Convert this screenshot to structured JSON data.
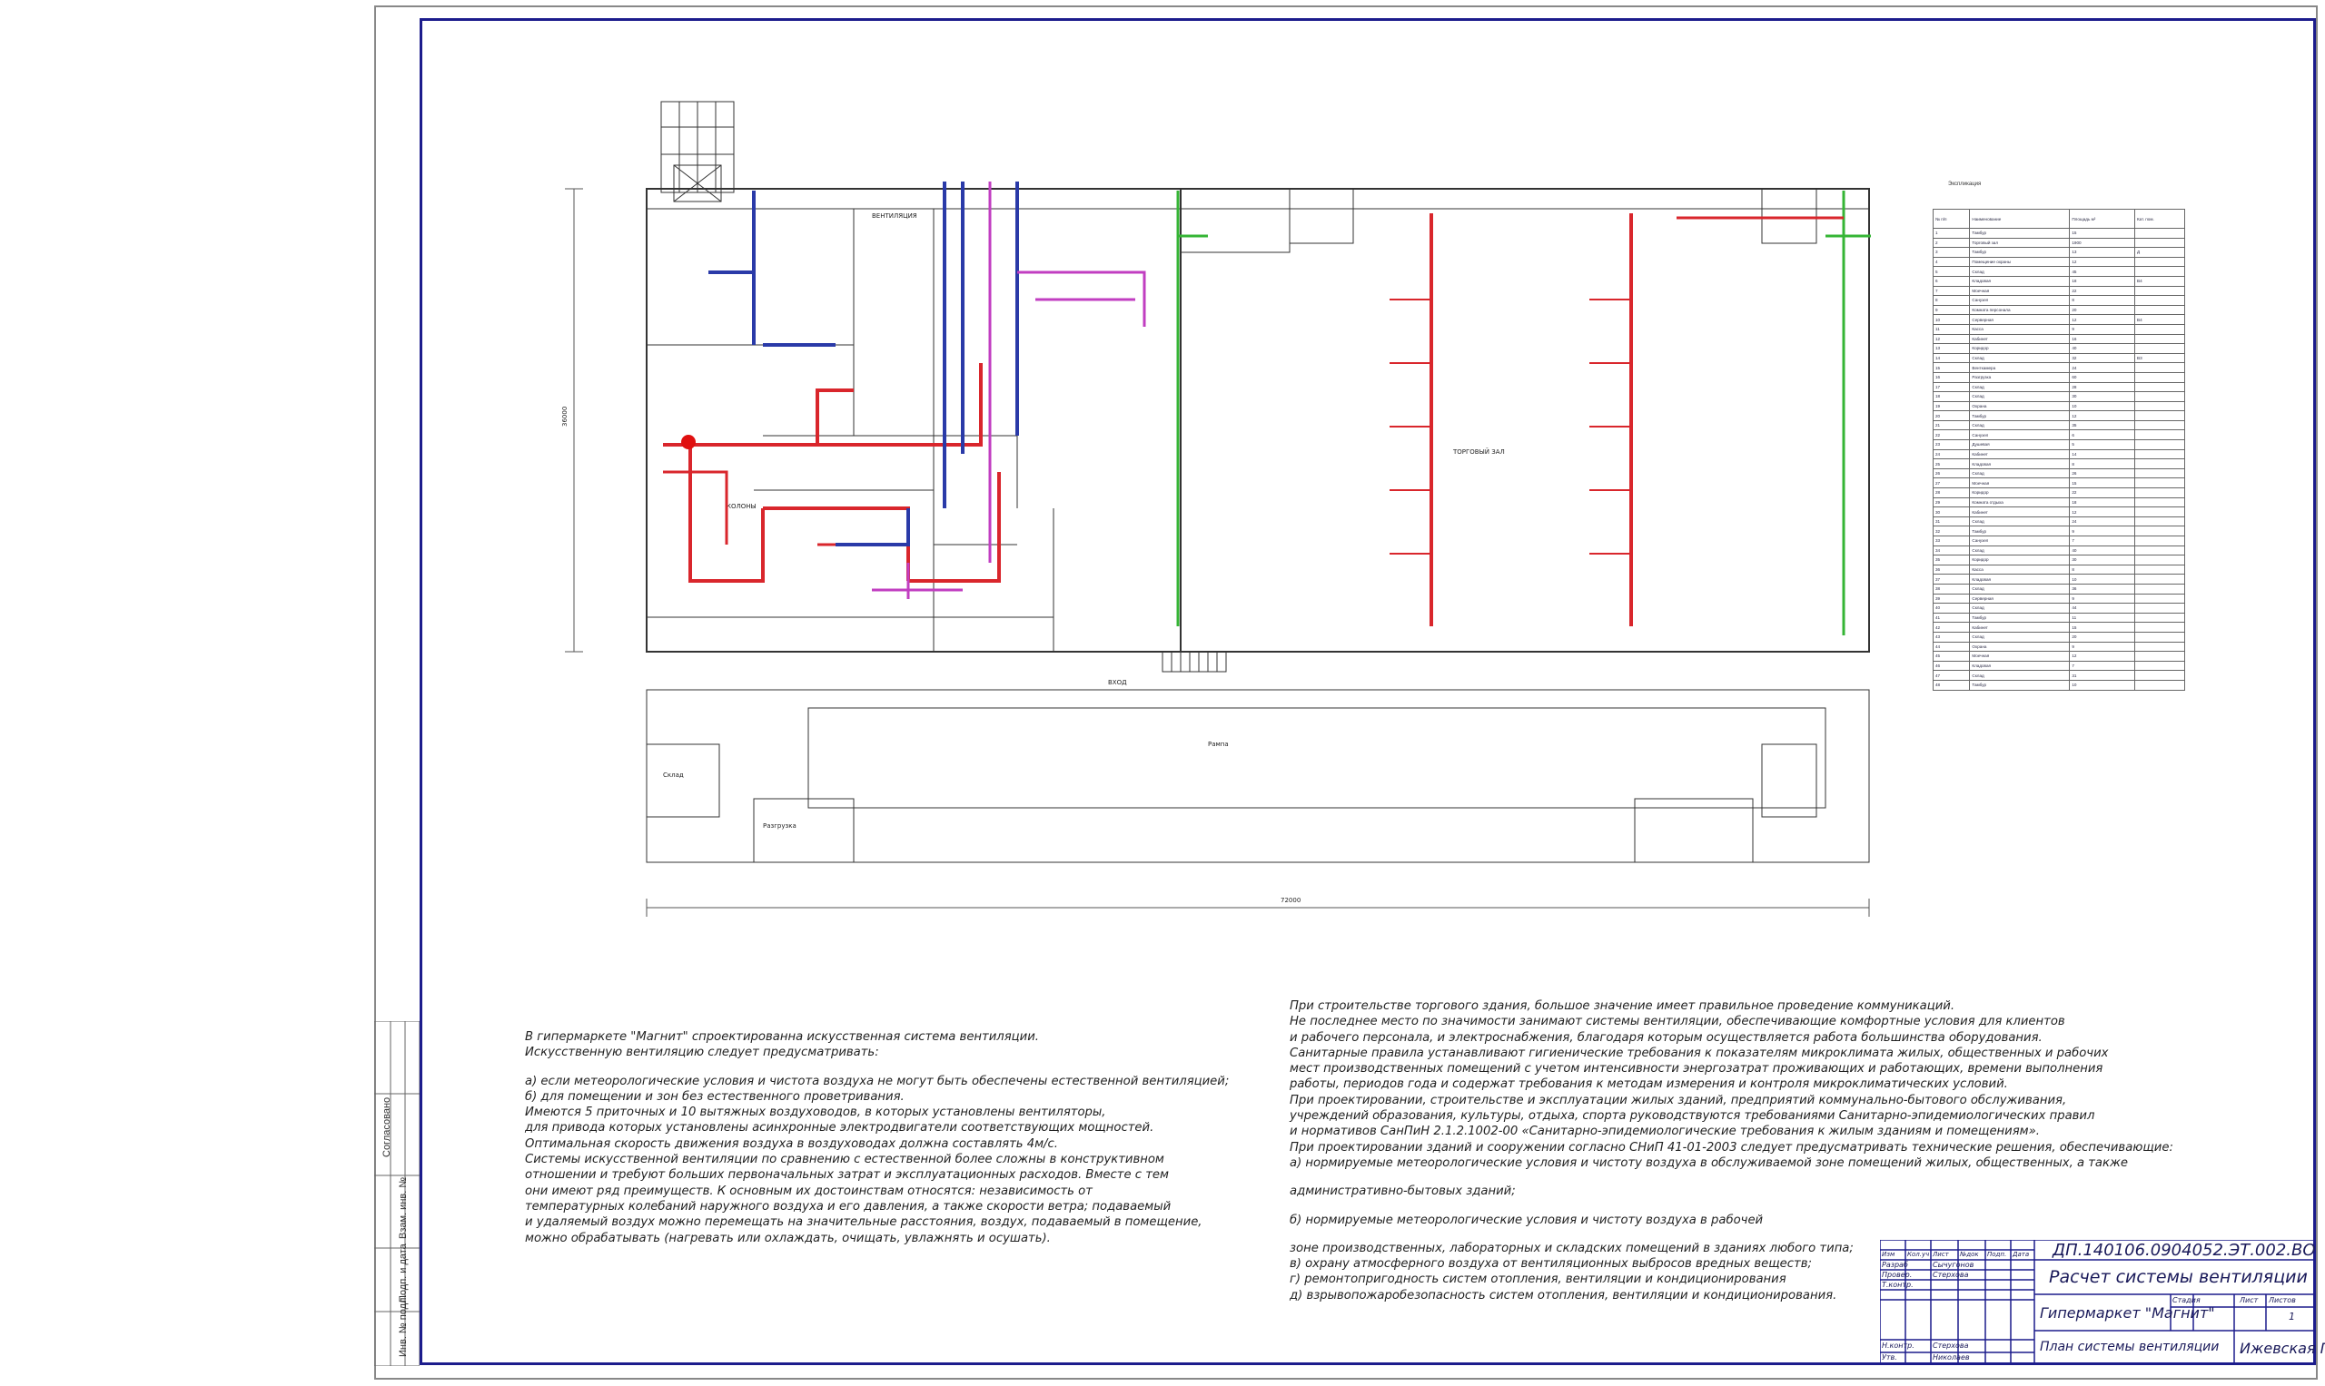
{
  "drawing": {
    "rooms": [
      "КОЛОНЫ",
      "ВЕНТИЛЯЦИЯ",
      "ТОРГОВЫЙ ЗАЛ",
      "ВХОД",
      "Тамбур",
      "Склад",
      "Разгрузка",
      "Охрана",
      "Касса",
      "Серверная",
      "Санузел",
      "Кабинет",
      "Моечная",
      "Кладовая"
    ],
    "dimension_bottom": "72000",
    "dimension_left": "36000",
    "entrance_label": "ВХОД",
    "loading_label": "Рампа"
  },
  "spec_table": {
    "title": "Экспликация",
    "headers": [
      "№ п/п",
      "Наименование",
      "Площадь м²",
      "Кат. пом."
    ],
    "rows": [
      [
        "1",
        "Тамбур",
        "15",
        ""
      ],
      [
        "2",
        "Торговый зал",
        "1900",
        ""
      ],
      [
        "3",
        "Тамбур",
        "13",
        "Д"
      ],
      [
        "4",
        "Помещение охраны",
        "12",
        ""
      ],
      [
        "5",
        "Склад",
        "45",
        ""
      ],
      [
        "6",
        "Кладовая",
        "18",
        "В4"
      ],
      [
        "7",
        "Моечная",
        "22",
        ""
      ],
      [
        "8",
        "Санузел",
        "8",
        ""
      ],
      [
        "9",
        "Комната персонала",
        "20",
        ""
      ],
      [
        "10",
        "Серверная",
        "12",
        "В4"
      ],
      [
        "11",
        "Касса",
        "9",
        ""
      ],
      [
        "12",
        "Кабинет",
        "16",
        ""
      ],
      [
        "13",
        "Коридор",
        "40",
        ""
      ],
      [
        "14",
        "Склад",
        "32",
        "В3"
      ],
      [
        "15",
        "Венткамера",
        "24",
        ""
      ],
      [
        "16",
        "Разгрузка",
        "60",
        ""
      ],
      [
        "17",
        "Склад",
        "28",
        ""
      ],
      [
        "18",
        "Склад",
        "30",
        ""
      ],
      [
        "19",
        "Охрана",
        "10",
        ""
      ],
      [
        "20",
        "Тамбур",
        "12",
        ""
      ],
      [
        "21",
        "Склад",
        "35",
        ""
      ],
      [
        "22",
        "Санузел",
        "6",
        ""
      ],
      [
        "23",
        "Душевая",
        "5",
        ""
      ],
      [
        "24",
        "Кабинет",
        "14",
        ""
      ],
      [
        "25",
        "Кладовая",
        "8",
        ""
      ],
      [
        "26",
        "Склад",
        "26",
        ""
      ],
      [
        "27",
        "Моечная",
        "15",
        ""
      ],
      [
        "28",
        "Коридор",
        "22",
        ""
      ],
      [
        "29",
        "Комната отдыха",
        "18",
        ""
      ],
      [
        "30",
        "Кабинет",
        "12",
        ""
      ],
      [
        "31",
        "Склад",
        "24",
        ""
      ],
      [
        "32",
        "Тамбур",
        "9",
        ""
      ],
      [
        "33",
        "Санузел",
        "7",
        ""
      ],
      [
        "34",
        "Склад",
        "40",
        ""
      ],
      [
        "35",
        "Коридор",
        "30",
        ""
      ],
      [
        "36",
        "Касса",
        "8",
        ""
      ],
      [
        "37",
        "Кладовая",
        "10",
        ""
      ],
      [
        "38",
        "Склад",
        "36",
        ""
      ],
      [
        "39",
        "Серверная",
        "9",
        ""
      ],
      [
        "40",
        "Склад",
        "44",
        ""
      ],
      [
        "41",
        "Тамбур",
        "11",
        ""
      ],
      [
        "42",
        "Кабинет",
        "15",
        ""
      ],
      [
        "43",
        "Склад",
        "20",
        ""
      ],
      [
        "44",
        "Охрана",
        "9",
        ""
      ],
      [
        "45",
        "Моечная",
        "12",
        ""
      ],
      [
        "46",
        "Кладовая",
        "7",
        ""
      ],
      [
        "47",
        "Склад",
        "31",
        ""
      ],
      [
        "48",
        "Тамбур",
        "10",
        ""
      ]
    ]
  },
  "notes_left": {
    "lines": [
      "В гипермаркете \"Магнит\" спроектированна искусственная система вентиляции.",
      "Искусственную вентиляцию следует предусматривать:",
      "",
      "а) если метеорологические условия и чистота воздуха не могут быть обеспечены естественной вентиляцией;",
      "б) для помещении и зон без естественного проветривания.",
      "Имеются 5 приточных и 10 вытяжных воздуховодов, в которых установлены вентиляторы,",
      "для привода которых установлены асинхронные электродвигатели соответствующих мощностей.",
      "Оптимальная скорость движения воздуха в воздуховодах должна составлять 4м/с.",
      "Системы искусственной вентиляции по сравнению с естественной более сложны в конструктивном",
      "отношении и требуют больших первоначальных затрат и эксплуатационных расходов. Вместе с тем",
      "они имеют ряд преимуществ. К основным их достоинствам относятся: независимость от",
      "температурных колебаний наружного воздуха и его давления, а также скорости ветра; подаваемый",
      "и удаляемый воздух можно перемещать на значительные расстояния, воздух, подаваемый в помещение,",
      "можно обрабатывать (нагревать или охлаждать, очищать, увлажнять и осушать)."
    ]
  },
  "notes_right": {
    "lines": [
      "При строительстве торгового здания, большое значение имеет правильное проведение коммуникаций.",
      "Не последнее место по значимости занимают системы вентиляции, обеспечивающие комфортные условия для клиентов",
      "и рабочего персонала, и электроснабжения, благодаря которым осуществляется работа большинства оборудования.",
      "Санитарные правила устанавливают гигиенические требования к показателям микроклимата жилых, общественных и рабочих",
      "мест производственных помещений с учетом интенсивности энергозатрат проживающих и работающих, времени выполнения",
      "работы, периодов года и содержат требования к методам измерения и контроля микроклиматических условий.",
      "При проектировании, строительстве и эксплуатации жилых зданий, предприятий коммунально-бытового обслуживания,",
      "учреждений образования, культуры, отдыха, спорта руководствуются требованиями Санитарно-эпидемиологических правил",
      " и нормативов СанПиН 2.1.2.1002-00 «Санитарно-эпидемиологические требования к жилым зданиям и помещениям».",
      "При проектировании зданий и сооружении согласно СНиП 41-01-2003 следует предусматривать технические решения, обеспечивающие:",
      "а) нормируемые метеорологические условия и чистоту воздуха в обслуживаемой зоне помещений жилых, общественных, а также",
      "",
      "административно-бытовых зданий;",
      "",
      "б) нормируемые метеорологические условия и чистоту воздуха в рабочей",
      "",
      "зоне производственных, лабораторных и складских помещений в зданиях любого типа;",
      "в) охрану атмосферного воздуха от вентиляционных выбросов вредных веществ;",
      "г) ремонтопригодность систем отопления, вентиляции и кондиционирования",
      "д) взрывопожаробезопасность систем отопления, вентиляции и кондиционирования."
    ]
  },
  "title_block": {
    "code": "ДП.140106.0904052.ЭТ.002.ВО",
    "title": "Расчет системы вентиляции",
    "object": "Гипермаркет \"Магнит\"",
    "sheet_name": "План системы вентиляции",
    "org": "Ижевская ГСХА",
    "stage_label": "Стадия",
    "sheet_label": "Лист",
    "sheets_label": "Листов",
    "sheets_count": "1",
    "headers": [
      "Изм",
      "Кол.уч",
      "Лист",
      "№док",
      "Подп.",
      "Дата"
    ],
    "roles": [
      "Разраб",
      "Провер.",
      "Т.контр.",
      "",
      "Н.контр.",
      "Утв."
    ],
    "names": [
      "Сычугонов",
      "Стерхова",
      "",
      "",
      "Стерхова",
      "Николаев"
    ]
  },
  "side_stamp": {
    "labels": [
      "Инв. № подл.",
      "Подп. и дата",
      "Взам. инв. №",
      "Согласовано"
    ]
  },
  "colors": {
    "frame": "#1c1c8c",
    "supply_duct": "#d9262c",
    "exhaust_duct": "#2a3aa8",
    "aux_duct": "#c13ec1",
    "green_duct": "#35b535",
    "walls": "#333333"
  }
}
